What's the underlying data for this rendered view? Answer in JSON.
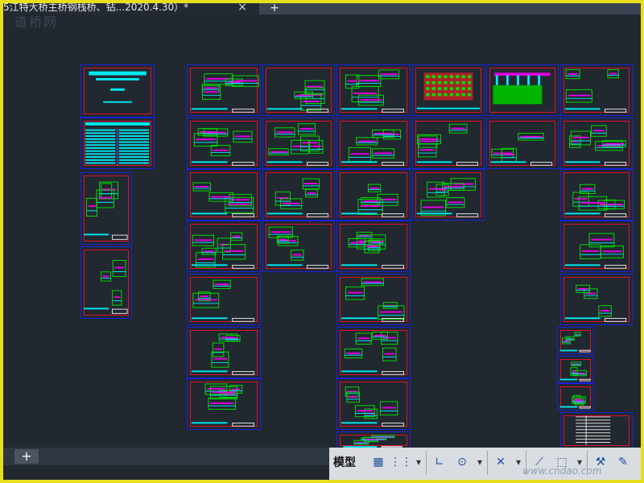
{
  "window": {
    "tab_title": "5江特大桥主桥钢栈桥、钻...2020.4.30）*",
    "tab_close_icon": "close-icon",
    "new_tab_label": "+"
  },
  "watermark": "道桥网",
  "layout_tabs": {
    "add_label": "+"
  },
  "statusbar": {
    "model_label": "模型",
    "icons": [
      "grid-icon",
      "snap-icon",
      "dropdown-icon",
      "ortho-icon",
      "polar-icon",
      "dropdown-icon",
      "osnap-icon",
      "dropdown-icon",
      "annotation-icon",
      "selection-icon",
      "dropdown-icon",
      "annoscale-icon",
      "settings-icon"
    ],
    "brand": "www.cndao.com"
  },
  "colors": {
    "background": "#212830",
    "sheet_border": "#1a21e0",
    "title_border": "#e0102e",
    "content_green": "#00e000",
    "content_cyan": "#00e8f0",
    "content_magenta": "#e000e0",
    "frame": "#e8df1c"
  }
}
